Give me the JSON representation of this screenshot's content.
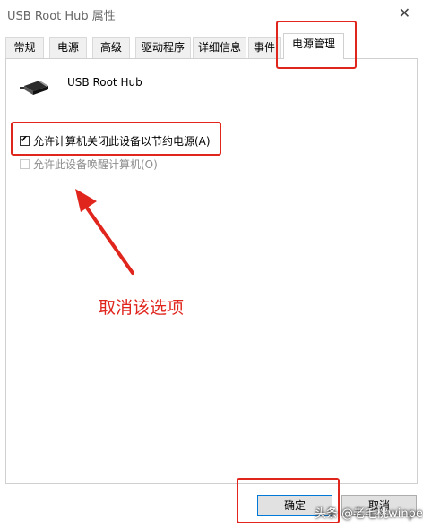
{
  "window": {
    "title": "USB Root Hub 属性",
    "close_glyph": "✕"
  },
  "tabs": [
    {
      "label": "常规"
    },
    {
      "label": "电源"
    },
    {
      "label": "高级"
    },
    {
      "label": "驱动程序"
    },
    {
      "label": "详细信息"
    },
    {
      "label": "事件"
    },
    {
      "label": "电源管理",
      "active": true
    }
  ],
  "device": {
    "name": "USB Root Hub",
    "icon": "usb-plug-icon"
  },
  "options": {
    "allow_turn_off": {
      "label": "允许计算机关闭此设备以节约电源(A)",
      "checked": true,
      "enabled": true
    },
    "allow_wake": {
      "label": "允许此设备唤醒计算机(O)",
      "checked": false,
      "enabled": false
    }
  },
  "annotation": {
    "text": "取消该选项",
    "color": "#e0251d"
  },
  "buttons": {
    "ok": "确定",
    "cancel": "取消"
  },
  "watermark": "头条 @老毛桃winpe"
}
